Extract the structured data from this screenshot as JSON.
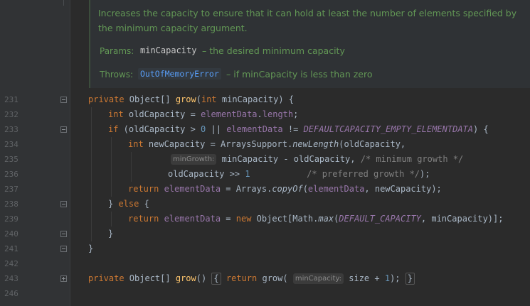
{
  "doc": {
    "description": "Increases the capacity to ensure that it can hold at least the number of elements specified by the minimum capacity argument.",
    "params_label": "Params:",
    "params_name": "minCapacity",
    "params_desc": "– the desired minimum capacity",
    "throws_label": "Throws:",
    "throws_name": "OutOfMemoryError",
    "throws_desc": "– if minCapacity is less than zero"
  },
  "line_numbers": {
    "l231": "231",
    "l232": "232",
    "l233": "233",
    "l234": "234",
    "l235": "235",
    "l236": "236",
    "l237": "237",
    "l238": "238",
    "l239": "239",
    "l240": "240",
    "l241": "241",
    "l242": "242",
    "l243": "243",
    "l246": "246"
  },
  "code": {
    "l231": {
      "kw": "private",
      "t1": " Object[] ",
      "fn": "grow",
      "t2": "(",
      "kw2": "int",
      "t3": " minCapacity) {"
    },
    "l232": {
      "kw": "int",
      "t1": " oldCapacity = ",
      "fld": "elementData",
      "t2": ".",
      "fld2": "length",
      "t3": ";"
    },
    "l233": {
      "kw": "if",
      "t1": " (oldCapacity > ",
      "num": "0",
      "t2": " || ",
      "fld": "elementData",
      "t3": " != ",
      "cst": "DEFAULTCAPACITY_EMPTY_ELEMENTDATA",
      "t4": ") {"
    },
    "l234": {
      "kw": "int",
      "t1": " newCapacity = ArraysSupport.",
      "it": "newLength",
      "t2": "(oldCapacity,"
    },
    "l235": {
      "hint": "minGrowth:",
      "t1": " minCapacity - oldCapacity, ",
      "cmt": "/* minimum growth */"
    },
    "l236": {
      "t1": "oldCapacity >> ",
      "num": "1",
      "t2": "           ",
      "cmt": "/* preferred growth */",
      "t3": ");"
    },
    "l237": {
      "kw": "return",
      "t1": " ",
      "fld": "elementData",
      "t2": " = Arrays.",
      "it": "copyOf",
      "t3": "(",
      "fld2": "elementData",
      "t4": ", newCapacity);"
    },
    "l238": {
      "t1": "} ",
      "kw": "else",
      "t2": " {"
    },
    "l239": {
      "kw": "return",
      "t1": " ",
      "fld": "elementData",
      "t2": " = ",
      "kw2": "new",
      "t3": " Object[Math.",
      "it": "max",
      "t4": "(",
      "cst": "DEFAULT_CAPACITY",
      "t5": ", minCapacity)];"
    },
    "l240": {
      "t1": "}"
    },
    "l241": {
      "t1": "}"
    },
    "l243": {
      "kw": "private",
      "t1": " Object[] ",
      "fn": "grow",
      "t2": "() ",
      "b1": "{",
      "t3": " ",
      "kw2": "return",
      "t4": " grow( ",
      "hint": "minCapacity:",
      "t5": " size + ",
      "num": "1",
      "t6": ");",
      "t7": " ",
      "b2": "}"
    }
  }
}
